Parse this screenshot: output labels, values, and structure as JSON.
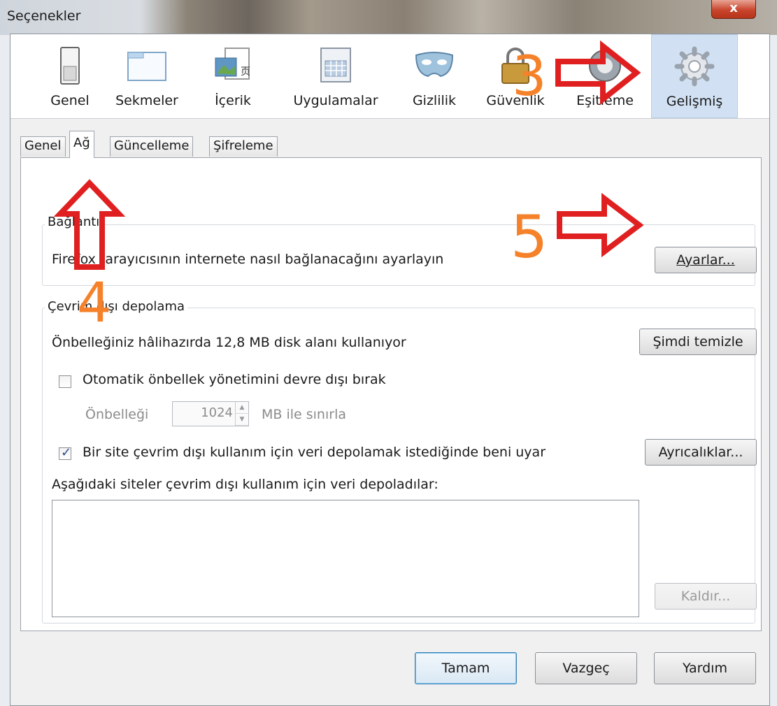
{
  "window": {
    "title": "Seçenekler",
    "close_glyph": "x"
  },
  "toolbar": {
    "items": [
      {
        "label": "Genel",
        "icon": "switch-icon"
      },
      {
        "label": "Sekmeler",
        "icon": "window-icon"
      },
      {
        "label": "İçerik",
        "icon": "content-icon"
      },
      {
        "label": "Uygulamalar",
        "icon": "calendar-icon"
      },
      {
        "label": "Gizlilik",
        "icon": "mask-icon"
      },
      {
        "label": "Güvenlik",
        "icon": "padlock-icon"
      },
      {
        "label": "Eşitleme",
        "icon": "sync-icon"
      },
      {
        "label": "Gelişmiş",
        "icon": "gear-icon"
      }
    ],
    "selected": "Gelişmiş"
  },
  "tabs": {
    "items": [
      "Genel",
      "Ağ",
      "Güncelleme",
      "Şifreleme"
    ],
    "selected": "Ağ"
  },
  "connection": {
    "title": "Bağlantı",
    "description": "Firefox tarayıcısının internete nasıl bağlanacağını ayarlayın",
    "settings_button": "Ayarlar..."
  },
  "offline": {
    "title": "Çevrim dışı depolama",
    "usage_text": "Önbelleğiniz hâlihazırda 12,8 MB disk alanı kullanıyor",
    "clear_button": "Şimdi temizle",
    "auto_cache_checkbox": "Otomatik önbellek yönetimini devre dışı bırak",
    "auto_cache_checked": false,
    "limit_label": "Önbelleği",
    "limit_value": "1024",
    "limit_unit": "MB ile sınırla",
    "warn_checkbox": "Bir site çevrim dışı kullanım için veri depolamak istediğinde beni uyar",
    "warn_checked": true,
    "exceptions_button": "Ayrıcalıklar...",
    "sites_label": "Aşağıdaki siteler çevrim dışı kullanım için veri depoladılar:",
    "remove_button": "Kaldır..."
  },
  "footer": {
    "ok": "Tamam",
    "cancel": "Vazgeç",
    "help": "Yardım"
  },
  "annotations": {
    "step3": "3",
    "step4": "4",
    "step5": "5"
  },
  "colors": {
    "annotation_arrow": "#e02020",
    "annotation_number": "#f5822a",
    "selected_toolbar": "#d1e1f3"
  }
}
